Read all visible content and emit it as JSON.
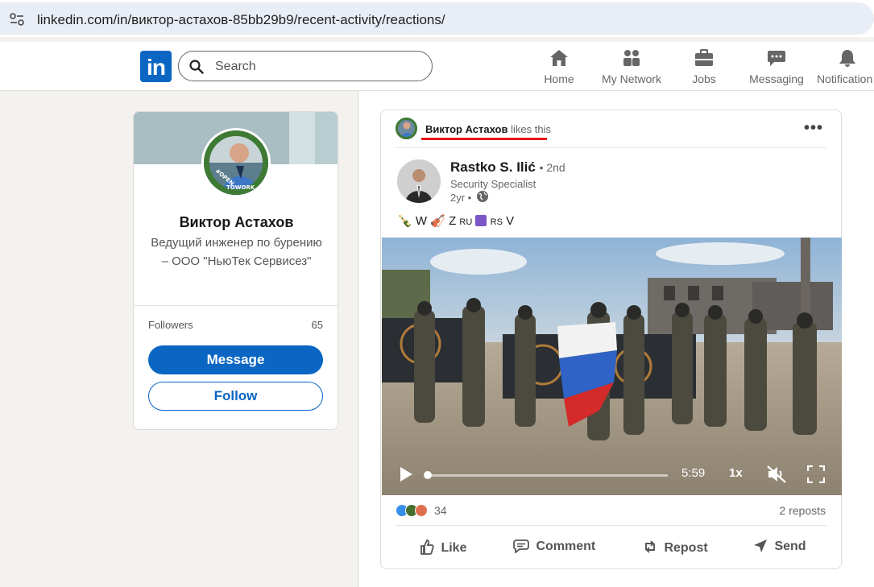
{
  "browser": {
    "url": "linkedin.com/in/виктор-астахов-85bb29b9/recent-activity/reactions/"
  },
  "nav": {
    "logo_text": "in",
    "search_placeholder": "Search",
    "items": [
      {
        "label": "Home",
        "icon": "home-icon"
      },
      {
        "label": "My Network",
        "icon": "my-network-icon"
      },
      {
        "label": "Jobs",
        "icon": "jobs-icon"
      },
      {
        "label": "Messaging",
        "icon": "messaging-icon"
      },
      {
        "label": "Notification",
        "icon": "notifications-icon"
      }
    ]
  },
  "profile": {
    "name": "Виктор Астахов",
    "headline": "Ведущий инженер по бурению – ООО \"НьюТек Сервисез\"",
    "followers_label": "Followers",
    "followers_count": "65",
    "message_button": "Message",
    "follow_button": "Follow",
    "badge": "#OPENTOWORK"
  },
  "post": {
    "activity_actor": "Виктор Астахов",
    "activity_verb": "likes this",
    "author": {
      "name": "Rastko S. Ilić",
      "degree": "• 2nd",
      "title": "Security Specialist",
      "age": "2yr •"
    },
    "text": {
      "w": "W",
      "z": "Z",
      "ru": "RU",
      "rs": "RS",
      "v": "V"
    },
    "video": {
      "time": "5:59",
      "speed": "1x",
      "progress": 0.0
    },
    "reactions_count": "34",
    "reposts": "2 reposts",
    "actions": {
      "like": "Like",
      "comment": "Comment",
      "repost": "Repost",
      "send": "Send"
    }
  },
  "colors": {
    "brand": "#0a66c2",
    "highlight_underline": "#e8141c"
  }
}
